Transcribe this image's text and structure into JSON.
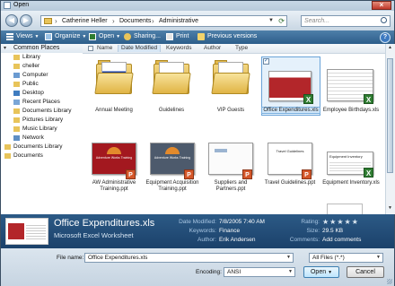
{
  "window": {
    "title": "Open",
    "close_label": "×"
  },
  "address": {
    "crumbs": [
      "Catherine Heller",
      "Documents",
      "Administrative"
    ],
    "search_placeholder": "Search..."
  },
  "toolbar": {
    "items": [
      "Views",
      "Organize",
      "Open",
      "Sharing...",
      "Print",
      "Previous versions"
    ],
    "help": "?"
  },
  "nav": {
    "header": "Common Places",
    "items": [
      "Library",
      "cheller",
      "Computer",
      "Public",
      "Desktop",
      "Recent Places",
      "Documents Library",
      "Pictures Library",
      "Music Library",
      "Network",
      "Documents Library",
      "Documents"
    ]
  },
  "columns": [
    "Name",
    "Date Modified",
    "Keywords",
    "Author",
    "Type"
  ],
  "files": [
    {
      "name": "Annual Meeting",
      "kind": "folder"
    },
    {
      "name": "Guidelines",
      "kind": "folder"
    },
    {
      "name": "VIP Guests",
      "kind": "folder"
    },
    {
      "name": "Office Expenditures.xls",
      "kind": "xls",
      "selected": true
    },
    {
      "name": "Employee Birthdays.xls",
      "kind": "xls"
    },
    {
      "name": "AW Administrative Training.ppt",
      "kind": "ppt"
    },
    {
      "name": "Equipment Acquisition Training.ppt",
      "kind": "ppt"
    },
    {
      "name": "Suppliers and Partners.ppt",
      "kind": "ppt"
    },
    {
      "name": "Travel Guidelines.ppt",
      "kind": "ppt"
    },
    {
      "name": "Equipment Inventory.xls",
      "kind": "xls"
    }
  ],
  "thumb_text": {
    "aw_banner": "Adventure Works Training",
    "equip_banner": "Adventure Works Training",
    "travel_title": "Travel Guidelines",
    "inventory_title": "Equipment Inventory"
  },
  "details": {
    "name": "Office Expenditures.xls",
    "type": "Microsoft Excel Worksheet",
    "date_modified_label": "Date Modified:",
    "date_modified": "7/8/2005 7:40 AM",
    "keywords_label": "Keywords:",
    "keywords": "Finance",
    "author_label": "Author:",
    "author": "Erik Andersen",
    "rating_label": "Rating:",
    "rating_stars": "★★★★★",
    "size_label": "Size:",
    "size": "29.5 KB",
    "comments_label": "Comments:",
    "comments": "Add comments"
  },
  "footer": {
    "filename_label": "File name:",
    "filename_value": "Office Expenditures.xls",
    "filter_value": "All Files (*.*)",
    "encoding_label": "Encoding:",
    "encoding_value": "ANSI",
    "open_label": "Open",
    "cancel_label": "Cancel"
  }
}
